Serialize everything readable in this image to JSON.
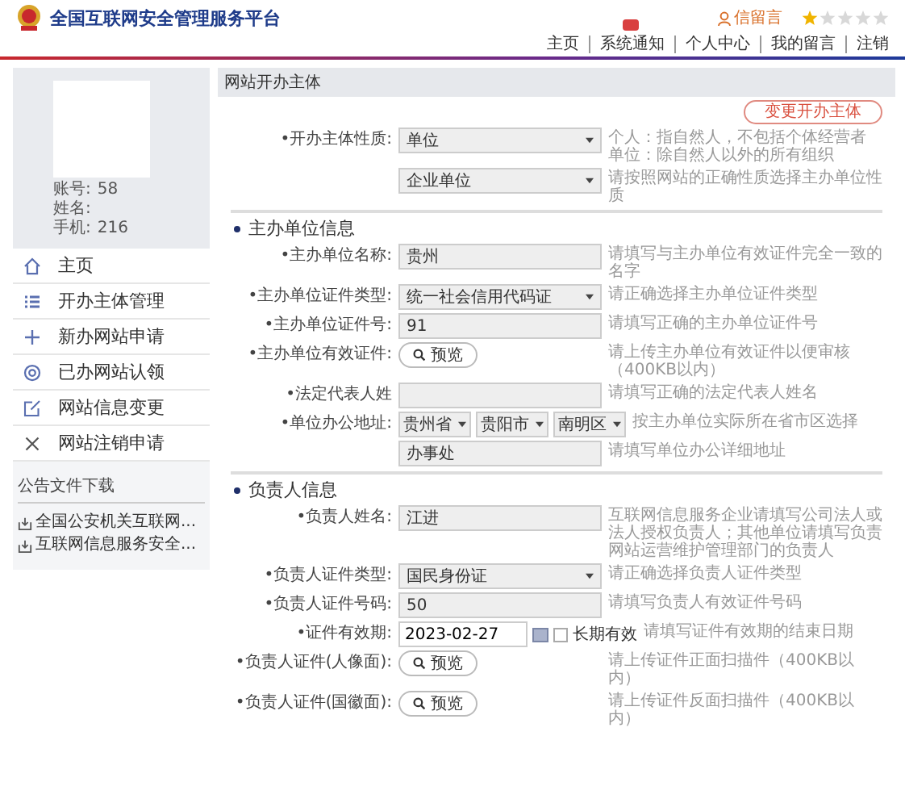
{
  "header": {
    "title": "全国互联网安全管理服务平台",
    "user_link": "信留言",
    "stars": 1,
    "nav": [
      {
        "label": "主页",
        "badge": false
      },
      {
        "label": "系统通知",
        "badge": true
      },
      {
        "label": "个人中心",
        "badge": false
      },
      {
        "label": "我的留言",
        "badge": false
      },
      {
        "label": "注销",
        "badge": false
      }
    ]
  },
  "sidebar": {
    "profile": [
      {
        "label": "账号:",
        "value": "58"
      },
      {
        "label": "姓名:"
      },
      {
        "label": "手机:",
        "value": "216"
      }
    ],
    "menu": [
      "主页",
      "开办主体管理",
      "新办网站申请",
      "已办网站认领",
      "网站信息变更",
      "网站注销申请"
    ],
    "downloads_title": "公告文件下载",
    "downloads": [
      "全国公安机关互联网...",
      "互联网信息服务安全..."
    ]
  },
  "panel": {
    "title": "网站开办主体",
    "change_button": "变更开办主体",
    "sections": [
      {
        "rows": [
          {
            "kind": "select",
            "label": "•开办主体性质:",
            "value": "单位",
            "hint": [
              "个人：指自然人，不包括个体经营者",
              "单位：除自然人以外的所有组织"
            ]
          },
          {
            "kind": "select",
            "label": "",
            "value": "企业单位",
            "hint": [
              "请按照网站的正确性质选择主办单位性质"
            ]
          }
        ]
      },
      {
        "heading": "主办单位信息",
        "rows": [
          {
            "kind": "input",
            "label": "•主办单位名称:",
            "value": "贵州",
            "hint": [
              "请填写与主办单位有效证件完全一致的名字"
            ]
          },
          {
            "kind": "select",
            "label": "•主办单位证件类型:",
            "value": "统一社会信用代码证",
            "hint": [
              "请正确选择主办单位证件类型"
            ]
          },
          {
            "kind": "input",
            "label": "•主办单位证件号:",
            "value": "91",
            "hint": [
              "请填写正确的主办单位证件号"
            ]
          },
          {
            "kind": "upload",
            "label": "•主办单位有效证件:",
            "value": "预览",
            "hint": [
              "请上传主办单位有效证件以便审核（400KB以内）"
            ]
          },
          {
            "kind": "input",
            "label": "•法定代表人姓",
            "value": "",
            "hint": [
              "请填写正确的法定代表人姓名"
            ]
          },
          {
            "kind": "address",
            "label": "•单位办公地址:",
            "options": [
              "贵州省",
              "贵阳市",
              "南明区"
            ],
            "hint": [
              "按主办单位实际所在省市区选择"
            ]
          },
          {
            "kind": "input",
            "label": "",
            "value": "办事处",
            "hint": [
              "请填写单位办公详细地址"
            ]
          }
        ]
      },
      {
        "heading": "负责人信息",
        "rows": [
          {
            "kind": "input",
            "label": "•负责人姓名:",
            "value": "江进",
            "hint": [
              "互联网信息服务企业请填写公司法人或法人授权负责人；其他单位请填写负责网站运营维护管理部门的负责人"
            ]
          },
          {
            "kind": "select",
            "label": "•负责人证件类型:",
            "value": "国民身份证",
            "hint": [
              "请正确选择负责人证件类型"
            ]
          },
          {
            "kind": "input",
            "label": "•负责人证件号码:",
            "value": "50",
            "hint": [
              "请填写负责人有效证件号码"
            ]
          },
          {
            "kind": "date",
            "label": "•证件有效期:",
            "value": "2023-02-27",
            "checkbox_label": "长期有效",
            "checked": false,
            "hint": [
              "请填写证件有效期的结束日期"
            ]
          },
          {
            "kind": "upload",
            "label": "•负责人证件(人像面):",
            "value": "预览",
            "hint": [
              "请上传证件正面扫描件（400KB以内）"
            ]
          },
          {
            "kind": "upload",
            "label": "•负责人证件(国徽面):",
            "value": "预览",
            "hint": [
              "请上传证件反面扫描件（400KB以内）"
            ]
          }
        ]
      }
    ]
  }
}
